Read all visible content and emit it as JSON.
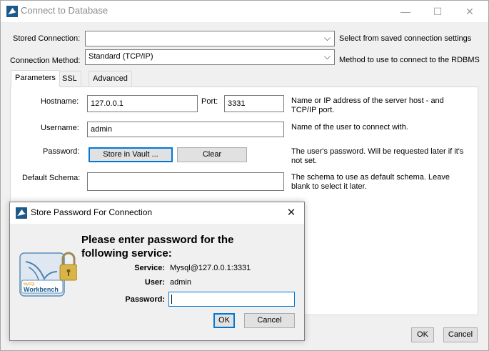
{
  "window": {
    "title": "Connect to Database",
    "controls": {
      "minimize": "—",
      "maximize": "☐",
      "close": "✕"
    }
  },
  "stored_connection": {
    "label": "Stored Connection:",
    "value": "",
    "hint": "Select from saved connection settings"
  },
  "connection_method": {
    "label": "Connection Method:",
    "value": "Standard (TCP/IP)",
    "hint": "Method to use to connect to the RDBMS"
  },
  "tabs": [
    {
      "label": "Parameters",
      "active": true
    },
    {
      "label": "SSL",
      "active": false
    },
    {
      "label": "Advanced",
      "active": false
    }
  ],
  "params": {
    "hostname": {
      "label": "Hostname:",
      "value": "127.0.0.1"
    },
    "port": {
      "label": "Port:",
      "value": "3331"
    },
    "host_hint": {
      "line1": "Name or IP address of the server host - and",
      "line2": "TCP/IP port."
    },
    "username": {
      "label": "Username:",
      "value": "admin",
      "hint": "Name of the user to connect with."
    },
    "password": {
      "label": "Password:",
      "store_button": "Store in Vault ...",
      "clear_button": "Clear",
      "hint_line1": "The user's password. Will be requested later if it's",
      "hint_line2": "not set."
    },
    "default_schema": {
      "label": "Default Schema:",
      "value": "",
      "hint_line1": "The schema to use as default schema. Leave",
      "hint_line2": "blank to select it later."
    }
  },
  "footer": {
    "ok": "OK",
    "cancel": "Cancel"
  },
  "dialog": {
    "title": "Store Password For Connection",
    "close": "✕",
    "heading_line1": "Please enter password for the",
    "heading_line2": "following service:",
    "service": {
      "label": "Service:",
      "value": "Mysql@127.0.0.1:3331"
    },
    "user": {
      "label": "User:",
      "value": "admin"
    },
    "password": {
      "label": "Password:",
      "value": ""
    },
    "ok": "OK",
    "cancel": "Cancel",
    "logo_text_small": "MySQL",
    "logo_text": "Workbench"
  },
  "colors": {
    "accent": "#0078d7",
    "window_bg": "#f0f0f0",
    "panel_bg": "#ffffff"
  }
}
